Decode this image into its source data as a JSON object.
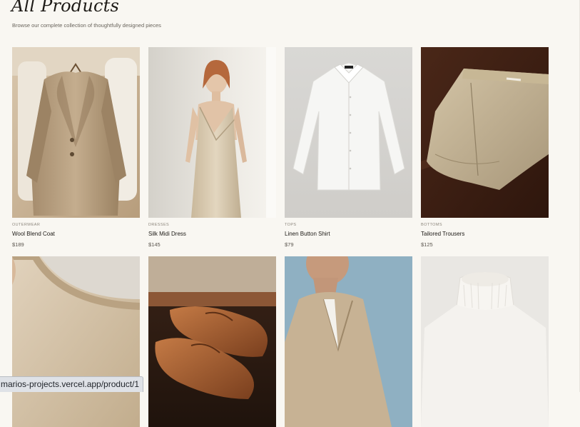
{
  "page": {
    "title": "All Products",
    "subtitle": "Browse our complete collection of thoughtfully designed pieces"
  },
  "products": [
    {
      "category": "OUTERWEAR",
      "name": "Wool Blend Coat",
      "price": "$189",
      "icon": "coat-image"
    },
    {
      "category": "DRESSES",
      "name": "Silk Midi Dress",
      "price": "$145",
      "icon": "dress-image"
    },
    {
      "category": "TOPS",
      "name": "Linen Button Shirt",
      "price": "$79",
      "icon": "shirt-image"
    },
    {
      "category": "BOTTOMS",
      "name": "Tailored Trousers",
      "price": "$125",
      "icon": "trousers-image"
    },
    {
      "category": "",
      "name": "",
      "price": "",
      "icon": "sweater-image"
    },
    {
      "category": "",
      "name": "",
      "price": "",
      "icon": "loafers-image"
    },
    {
      "category": "",
      "name": "",
      "price": "",
      "icon": "blazer-image"
    },
    {
      "category": "",
      "name": "",
      "price": "",
      "icon": "turtleneck-image"
    }
  ],
  "status_bar": {
    "url": "marios-projects.vercel.app/product/1"
  },
  "colors": {
    "background": "#f9f7f2",
    "text": "#1d1a16",
    "muted": "#8b857b"
  }
}
